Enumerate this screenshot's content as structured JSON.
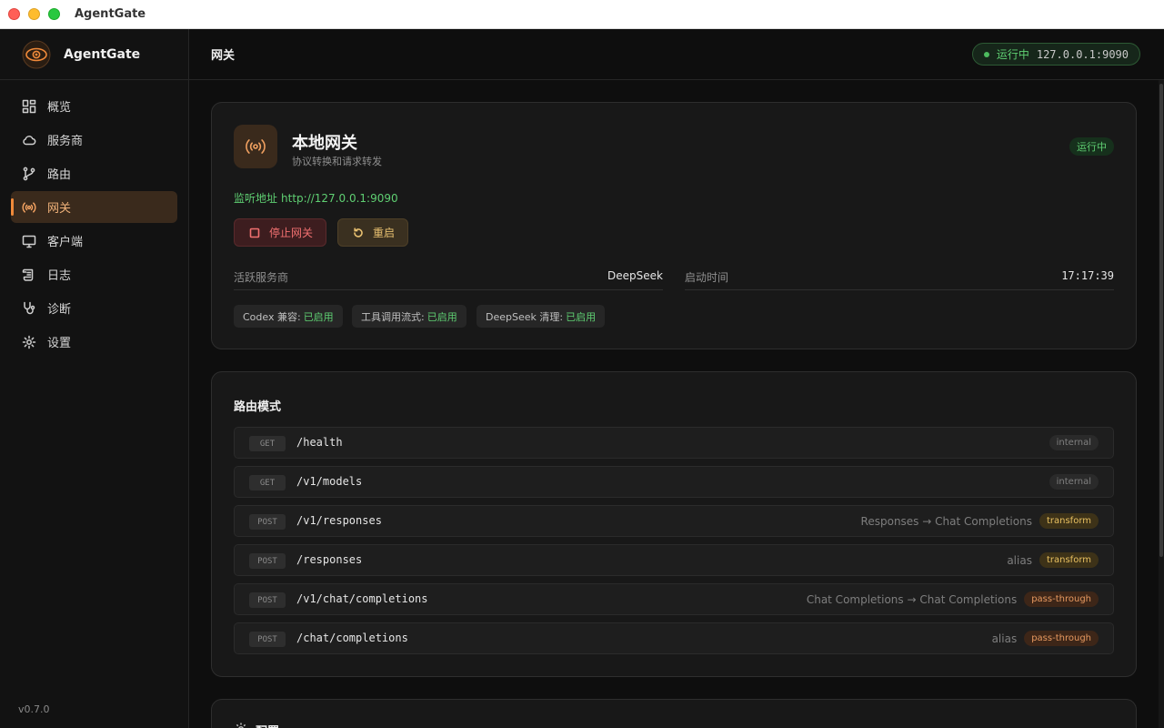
{
  "window": {
    "title": "AgentGate"
  },
  "brand": {
    "name": "AgentGate"
  },
  "nav": {
    "items": [
      {
        "label": "概览",
        "icon": "dashboard-icon"
      },
      {
        "label": "服务商",
        "icon": "cloud-icon"
      },
      {
        "label": "路由",
        "icon": "git-branch-icon"
      },
      {
        "label": "网关",
        "icon": "broadcast-icon",
        "active": true
      },
      {
        "label": "客户端",
        "icon": "monitor-icon"
      },
      {
        "label": "日志",
        "icon": "scroll-icon"
      },
      {
        "label": "诊断",
        "icon": "stethoscope-icon"
      },
      {
        "label": "设置",
        "icon": "gear-icon"
      }
    ]
  },
  "version": "v0.7.0",
  "header": {
    "title": "网关",
    "status_label": "运行中",
    "status_addr": "127.0.0.1:9090"
  },
  "gateway": {
    "title": "本地网关",
    "subtitle": "协议转换和请求转发",
    "badge": "运行中",
    "listen_label": "监听地址",
    "listen_url": "http://127.0.0.1:9090",
    "stop_label": "停止网关",
    "restart_label": "重启",
    "active_provider_label": "活跃服务商",
    "active_provider_value": "DeepSeek",
    "start_time_label": "启动时间",
    "start_time_value": "17:17:39",
    "features": [
      {
        "name": "Codex 兼容:",
        "state": "已启用"
      },
      {
        "name": "工具调用流式:",
        "state": "已启用"
      },
      {
        "name": "DeepSeek 清理:",
        "state": "已启用"
      }
    ]
  },
  "routes": {
    "title": "路由模式",
    "items": [
      {
        "method": "GET",
        "path": "/health",
        "desc": "",
        "tag": "internal"
      },
      {
        "method": "GET",
        "path": "/v1/models",
        "desc": "",
        "tag": "internal"
      },
      {
        "method": "POST",
        "path": "/v1/responses",
        "desc": "Responses → Chat Completions",
        "tag": "transform"
      },
      {
        "method": "POST",
        "path": "/responses",
        "desc": "alias",
        "tag": "transform"
      },
      {
        "method": "POST",
        "path": "/v1/chat/completions",
        "desc": "Chat Completions → Chat Completions",
        "tag": "pass-through"
      },
      {
        "method": "POST",
        "path": "/chat/completions",
        "desc": "alias",
        "tag": "pass-through"
      }
    ]
  },
  "config": {
    "title": "配置"
  },
  "colors": {
    "accent": "#f08a3a",
    "success": "#5fcf72",
    "danger": "#f07070",
    "warning": "#e8c070"
  }
}
